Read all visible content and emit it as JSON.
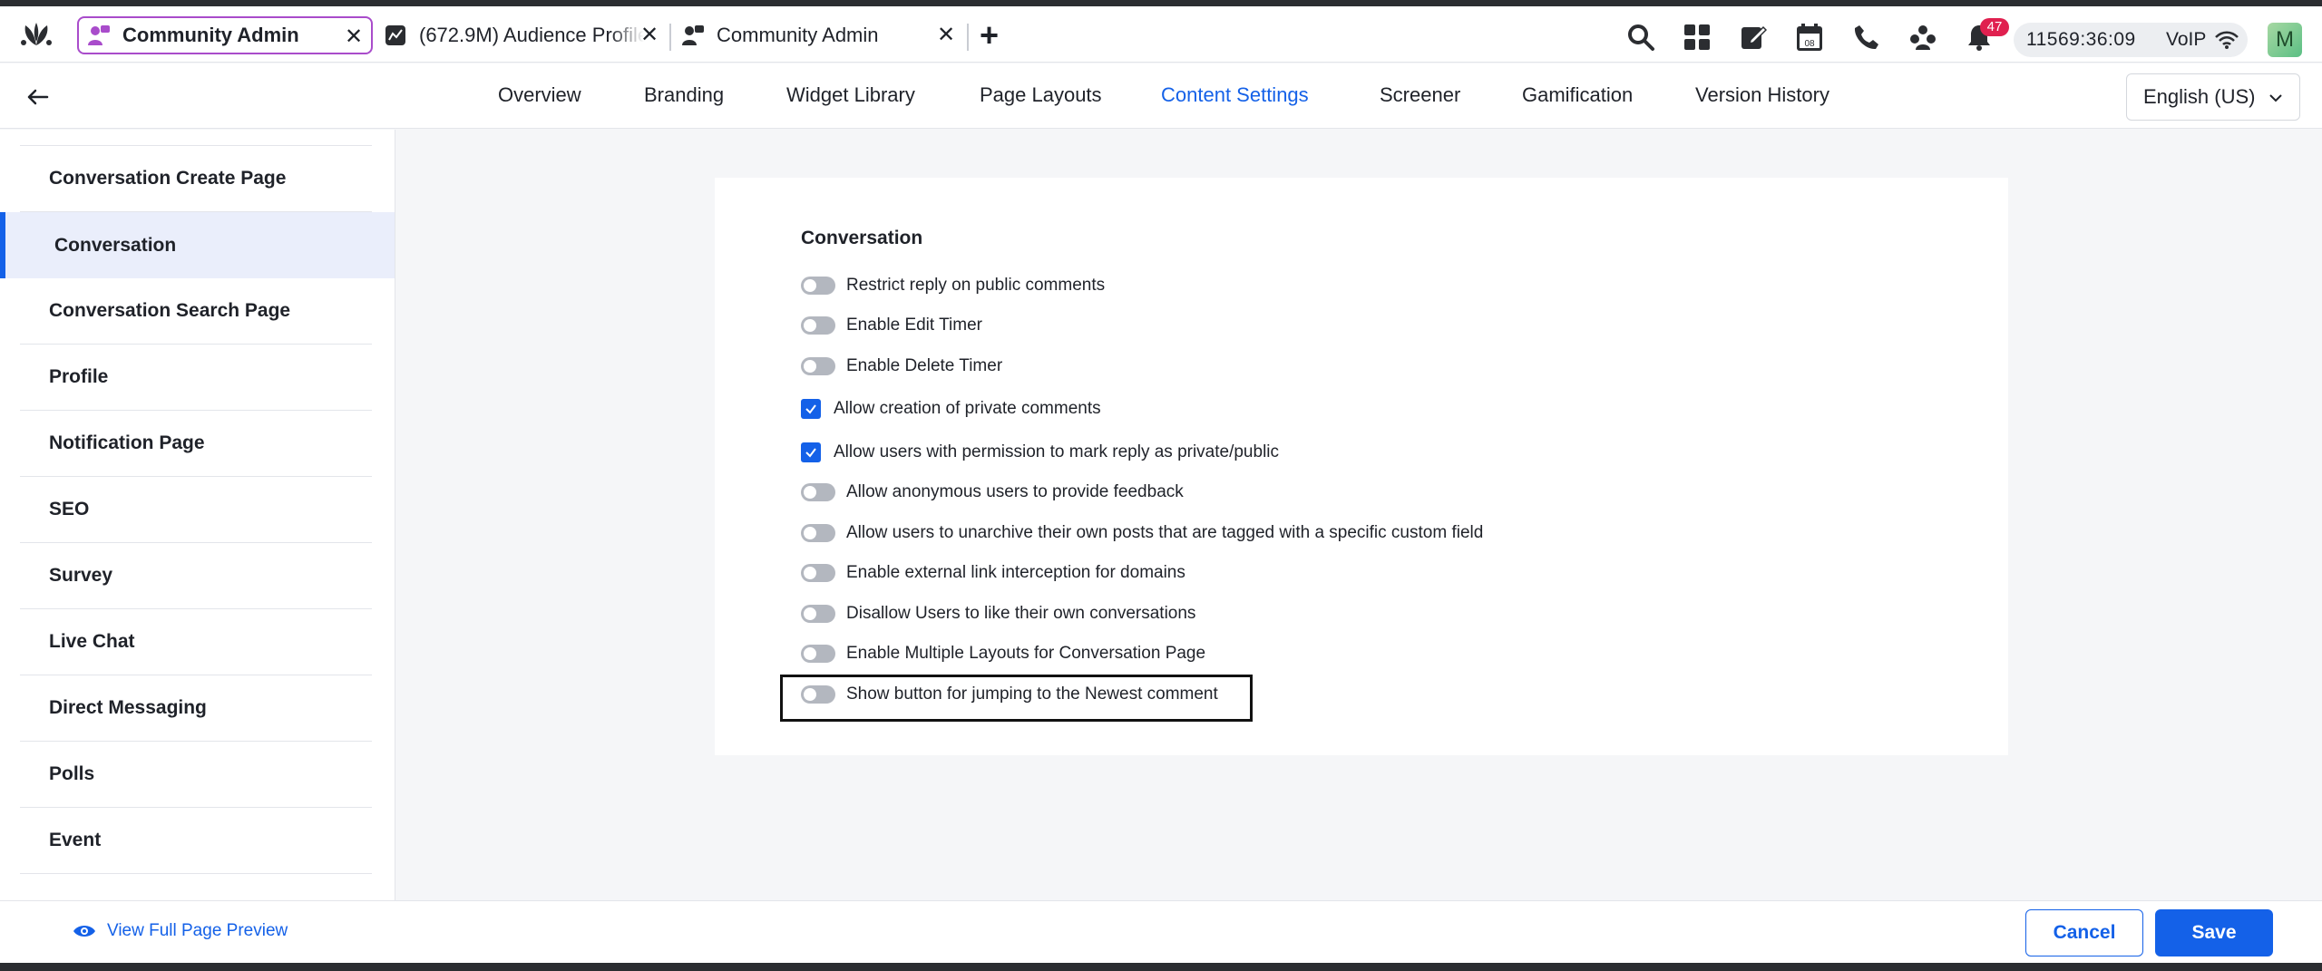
{
  "tabs": [
    {
      "title": "Community Admin",
      "active": true
    },
    {
      "title": "(672.9M) Audience Profile"
    },
    {
      "title": "Community Admin"
    }
  ],
  "toolbar": {
    "notification_count": "47",
    "timer": "11569:36:09",
    "voip_label": "VoIP",
    "avatar_initial": "M",
    "calendar_day": "08"
  },
  "nav": {
    "items": [
      "Overview",
      "Branding",
      "Widget Library",
      "Page Layouts",
      "Content Settings",
      "Screener",
      "Gamification",
      "Version History"
    ],
    "active": "Content Settings",
    "language": "English (US)"
  },
  "sidebar": {
    "items": [
      "Conversation Create Page",
      "Conversation",
      "Conversation Search Page",
      "Profile",
      "Notification Page",
      "SEO",
      "Survey",
      "Live Chat",
      "Direct Messaging",
      "Polls",
      "Event"
    ],
    "active": "Conversation"
  },
  "section": {
    "title": "Conversation",
    "options": [
      {
        "label": "Restrict reply on public comments",
        "type": "toggle",
        "value": false
      },
      {
        "label": "Enable Edit Timer",
        "type": "toggle",
        "value": false
      },
      {
        "label": "Enable Delete Timer",
        "type": "toggle",
        "value": false
      },
      {
        "label": "Allow creation of private comments",
        "type": "checkbox",
        "value": true
      },
      {
        "label": "Allow users with permission to mark reply as private/public",
        "type": "checkbox",
        "value": true
      },
      {
        "label": "Allow anonymous users to provide feedback",
        "type": "toggle",
        "value": false
      },
      {
        "label": "Allow users to unarchive their own posts that are tagged with a specific custom field",
        "type": "toggle",
        "value": false
      },
      {
        "label": "Enable external link interception for domains",
        "type": "toggle",
        "value": false
      },
      {
        "label": "Disallow Users to like their own conversations",
        "type": "toggle",
        "value": false
      },
      {
        "label": "Enable Multiple Layouts for Conversation Page",
        "type": "toggle",
        "value": false
      },
      {
        "label": "Show button for jumping to the Newest comment",
        "type": "toggle",
        "value": false
      }
    ]
  },
  "footer": {
    "preview_label": "View Full Page Preview",
    "cancel_label": "Cancel",
    "save_label": "Save"
  },
  "colors": {
    "accent": "#1461e8",
    "active_tab_border": "#a94ccb",
    "badge": "#e0204f"
  }
}
